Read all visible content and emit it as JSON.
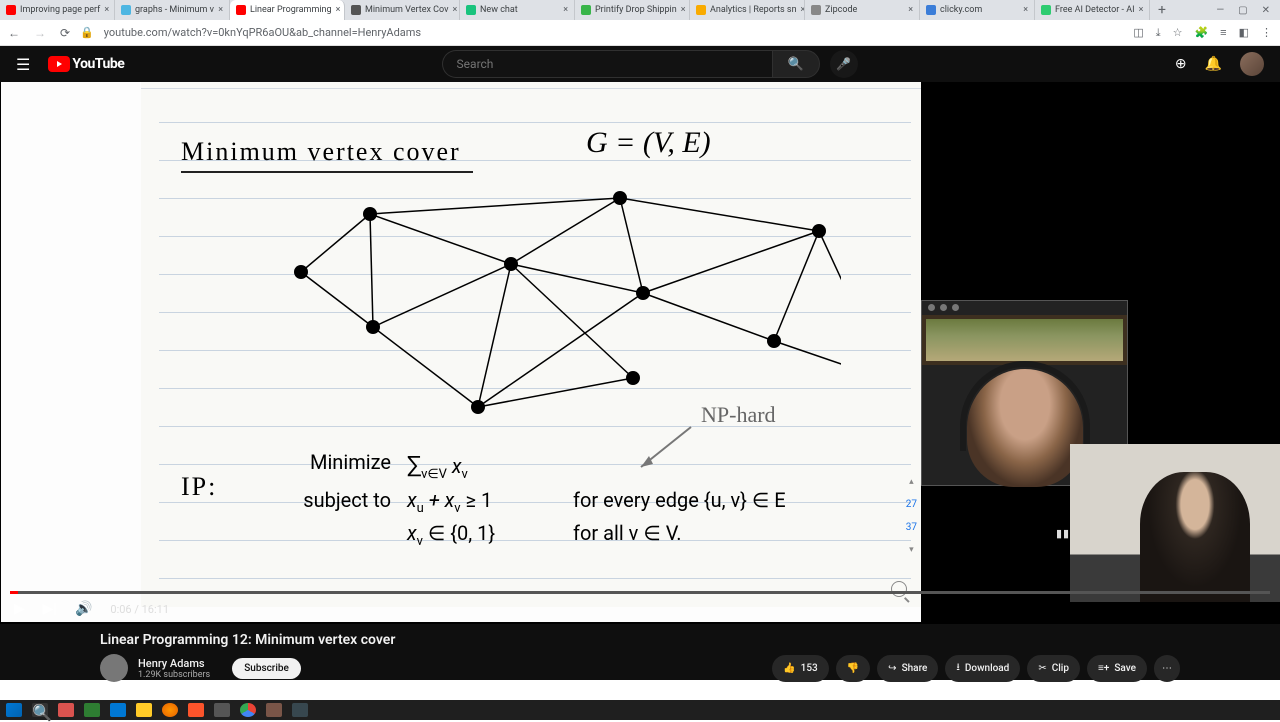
{
  "tabs": [
    {
      "title": "Improving page perf",
      "fav": "#ff0000"
    },
    {
      "title": "graphs - Minimum v",
      "fav": "#4db6e2"
    },
    {
      "title": "Linear Programming",
      "fav": "#ff0000",
      "active": true
    },
    {
      "title": "Minimum Vertex Cov",
      "fav": "#555"
    },
    {
      "title": "New chat",
      "fav": "#19c37d"
    },
    {
      "title": "Printify Drop Shippin",
      "fav": "#39b54a"
    },
    {
      "title": "Analytics | Reports sn",
      "fav": "#f9ab00"
    },
    {
      "title": "Zipcode",
      "fav": "#888"
    },
    {
      "title": "clicky.com",
      "fav": "#3b7dd8"
    },
    {
      "title": "Free AI Detector - AI",
      "fav": "#2ecc71"
    }
  ],
  "url": "youtube.com/watch?v=0knYqPR6aOU&ab_channel=HenryAdams",
  "yt": {
    "brand": "YouTube",
    "search_placeholder": "Search"
  },
  "slide": {
    "title": "Minimum  vertex  cover",
    "g": "G = (V, E)",
    "np": "NP-hard",
    "ip": "IP:",
    "min": "Minimize",
    "subj": "subject to",
    "obj": "∑",
    "obj_sub": "v∈V",
    "obj_x": " x",
    "obj_xv": "v",
    "c1": "x",
    "c1u": "u",
    "c1plus": " + x",
    "c1v": "v",
    "c1ge": " ≥ 1",
    "c1r": "for every edge {u, v} ∈ E",
    "c2": "x",
    "c2v": "v",
    "c2in": " ∈ {0, 1}",
    "c2r": "for all v ∈ V.",
    "pg1": "27",
    "pg2": "37"
  },
  "player": {
    "time": "0:06 / 16:11"
  },
  "video": {
    "title": "Linear Programming 12: Minimum vertex cover",
    "channel": "Henry Adams",
    "subs": "1.29K subscribers",
    "subscribe": "Subscribe",
    "likes": "153",
    "share": "Share",
    "download": "Download",
    "clip": "Clip",
    "save": "Save"
  }
}
